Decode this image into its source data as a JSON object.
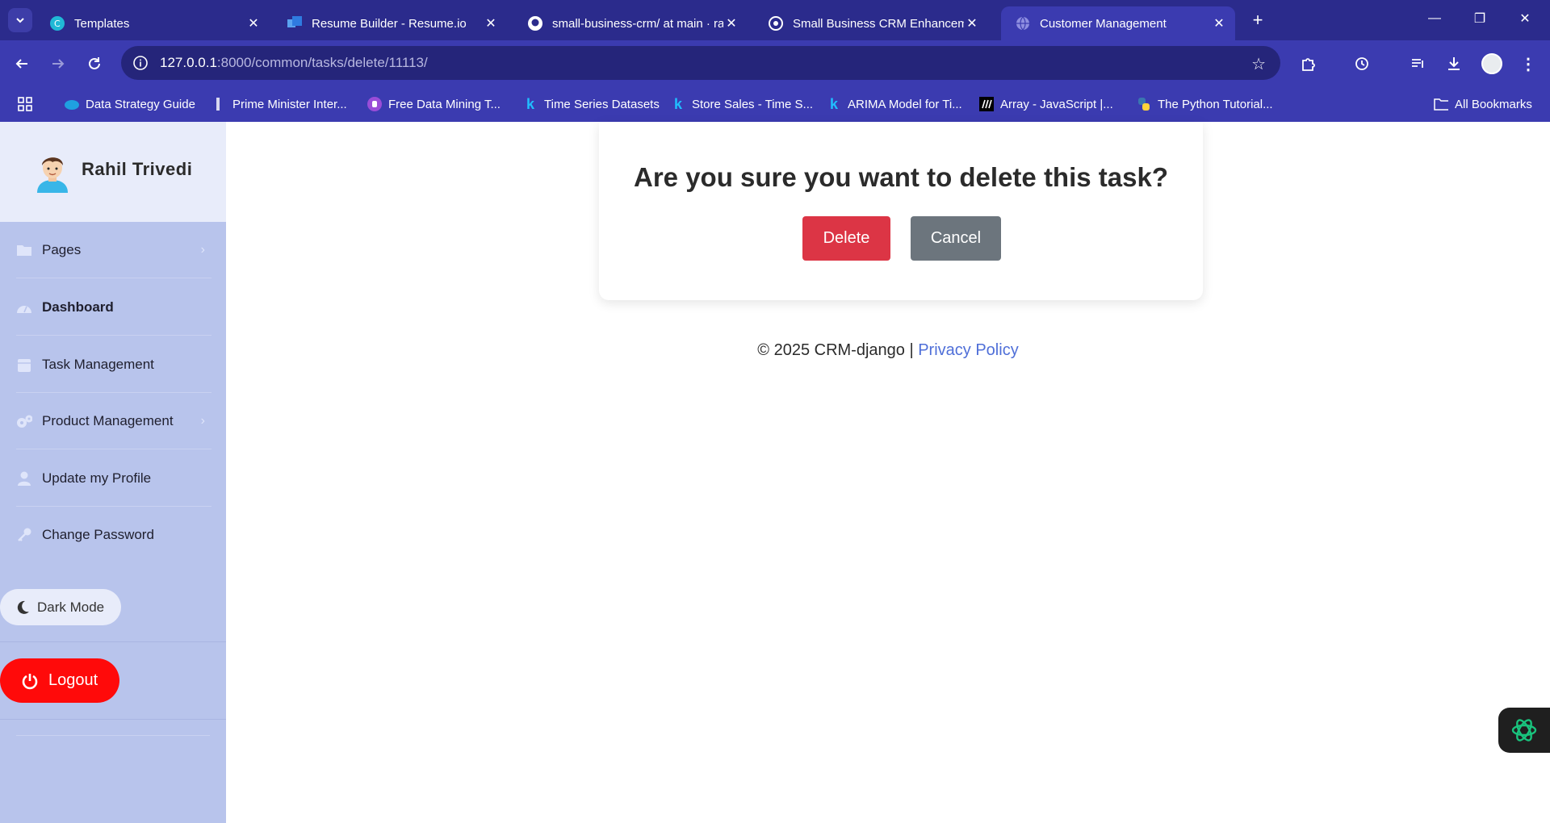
{
  "browser": {
    "tabs": [
      {
        "title": "Templates",
        "favicon": "canva-icon",
        "active": false
      },
      {
        "title": "Resume Builder - Resume.io",
        "favicon": "resume-icon",
        "active": false
      },
      {
        "title": "small-business-crm/ at main · ra",
        "favicon": "github-icon",
        "active": false
      },
      {
        "title": "Small Business CRM Enhanceme",
        "favicon": "openai-icon",
        "active": false
      },
      {
        "title": "Customer Management",
        "favicon": "globe-icon",
        "active": true
      }
    ],
    "url_host": "127.0.0.1",
    "url_rest": ":8000/common/tasks/delete/11113/",
    "bookmarks": [
      {
        "label": "Data Strategy Guide",
        "icon": "cloud-icon"
      },
      {
        "label": "Prime Minister Inter...",
        "icon": "doc-icon"
      },
      {
        "label": "Free Data Mining T...",
        "icon": "shield-icon"
      },
      {
        "label": "Time Series Datasets",
        "icon": "kaggle-icon"
      },
      {
        "label": "Store Sales - Time S...",
        "icon": "kaggle-icon"
      },
      {
        "label": "ARIMA Model for Ti...",
        "icon": "kaggle-icon"
      },
      {
        "label": "Array - JavaScript |...",
        "icon": "mdn-icon"
      },
      {
        "label": "The Python Tutorial...",
        "icon": "python-icon"
      }
    ],
    "all_bookmarks": "All Bookmarks"
  },
  "sidebar": {
    "username": "Rahil Trivedi",
    "items": [
      {
        "label": "Pages",
        "icon": "folder-icon",
        "has_chevron": true
      },
      {
        "label": "Dashboard",
        "icon": "dashboard-icon",
        "has_chevron": false
      },
      {
        "label": "Task Management",
        "icon": "calendar-icon",
        "has_chevron": false
      },
      {
        "label": "Product Management",
        "icon": "cogs-icon",
        "has_chevron": true
      },
      {
        "label": "Update my Profile",
        "icon": "user-icon",
        "has_chevron": false
      },
      {
        "label": "Change Password",
        "icon": "key-icon",
        "has_chevron": false
      }
    ],
    "dark_mode_label": "Dark Mode",
    "logout_label": "Logout"
  },
  "dialog": {
    "title": "Are you sure you want to delete this task?",
    "delete_label": "Delete",
    "cancel_label": "Cancel"
  },
  "footer": {
    "copyright": "© 2025 CRM-django | ",
    "privacy_link": "Privacy Policy"
  },
  "colors": {
    "chrome": "#3b3bb0",
    "sidebar": "#b8c4ec",
    "delete": "#dc3545",
    "cancel": "#6c757d",
    "logout": "#ff0a0a",
    "link": "#4f6fd8"
  }
}
